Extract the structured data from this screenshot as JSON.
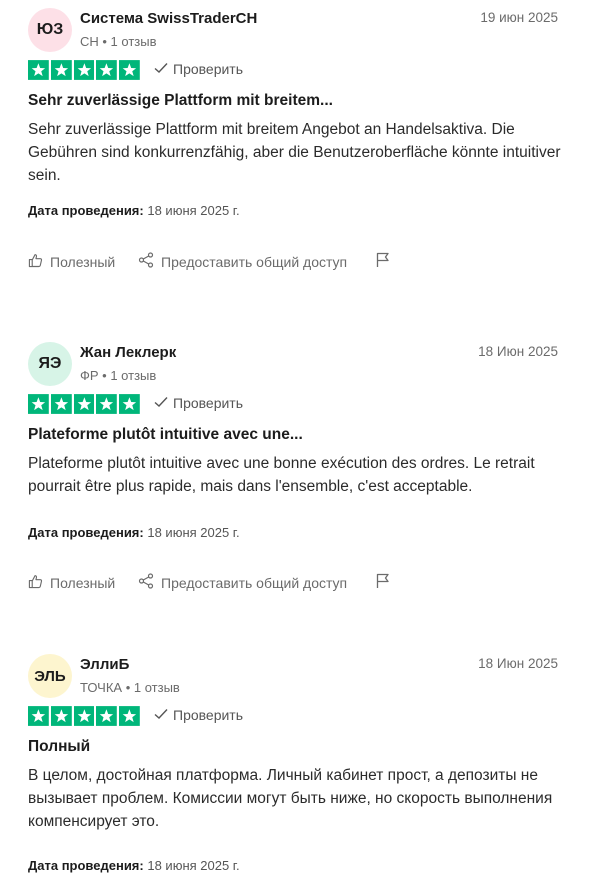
{
  "actions": {
    "useful_label": "Полезный",
    "share_label": "Предоставить общий доступ"
  },
  "verify_label": "Проверить",
  "exp_label": "Дата проведения:",
  "colors": {
    "star_green": "#00b67a",
    "avatar_1": "#fde0e7",
    "avatar_2": "#d7f4e7",
    "avatar_3": "#fdf5cf"
  },
  "reviews": [
    {
      "initials": "ЮЗ",
      "name": "Система SwissTraderCH",
      "meta": "CH • 1 отзыв",
      "date": "19 июн 2025",
      "rating": 5,
      "title": "Sehr zuverlässige Plattform mit breitem...",
      "body": "Sehr zuverlässige Plattform mit breitem Angebot an Handelsaktiva. Die Gebühren sind konkurrenzfähig, aber die Benutzeroberfläche könnte intuitiver sein.",
      "experience_date": "18 июня 2025 г."
    },
    {
      "initials": "ЯЭ",
      "name": "Жан Леклерк",
      "meta": "ФР • 1 отзыв",
      "date": "18 Июн 2025",
      "rating": 5,
      "title": "Plateforme plutôt intuitive avec une...",
      "body": "Plateforme plutôt intuitive avec une bonne exécution des ordres. Le retrait pourrait être plus rapide, mais dans l'ensemble, c'est acceptable.",
      "experience_date": "18 июня 2025 г."
    },
    {
      "initials": "ЭЛЬ",
      "name": "ЭллиБ",
      "meta": "ТОЧКА • 1 отзыв",
      "date": "18 Июн 2025",
      "rating": 5,
      "title": "Полный",
      "body": "В целом, достойная платформа. Личный кабинет прост, а депозиты не вызывает проблем. Комиссии могут быть ниже, но скорость выполнения компенсирует это.",
      "experience_date": "18 июня 2025 г."
    }
  ]
}
